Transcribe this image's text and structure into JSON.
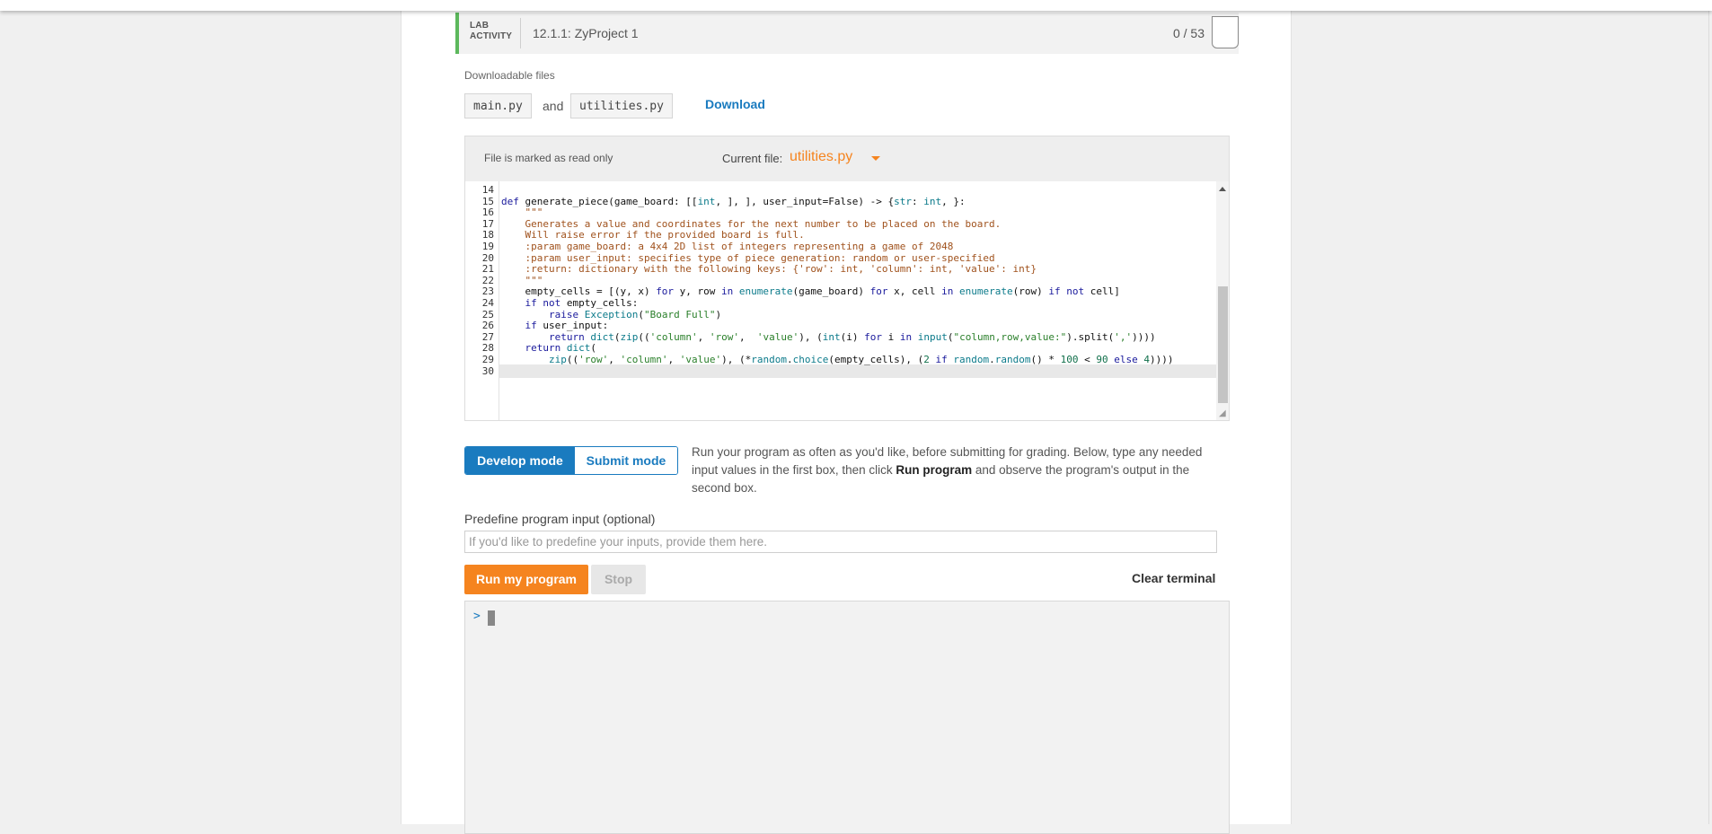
{
  "lab": {
    "tag_line1": "LAB",
    "tag_line2": "ACTIVITY",
    "title": "12.1.1: ZyProject 1",
    "score": "0 / 53"
  },
  "downloads": {
    "label": "Downloadable files",
    "file1": "main.py",
    "and_text": "and",
    "file2": "utilities.py",
    "download_label": "Download"
  },
  "editor": {
    "readonly_note": "File is marked as read only",
    "current_file_label": "Current file:",
    "current_file": "utilities.py",
    "active_line": 30,
    "lines": [
      {
        "n": "14",
        "code": ""
      },
      {
        "n": "15",
        "code": "def generate_piece(game_board: [[int, ], ], user_input=False) -> {str: int, }:"
      },
      {
        "n": "16",
        "code": "    \"\"\""
      },
      {
        "n": "17",
        "code": "    Generates a value and coordinates for the next number to be placed on the board."
      },
      {
        "n": "18",
        "code": "    Will raise error if the provided board is full."
      },
      {
        "n": "19",
        "code": "    :param game_board: a 4x4 2D list of integers representing a game of 2048"
      },
      {
        "n": "20",
        "code": "    :param user_input: specifies type of piece generation: random or user-specified"
      },
      {
        "n": "21",
        "code": "    :return: dictionary with the following keys: {'row': int, 'column': int, 'value': int}"
      },
      {
        "n": "22",
        "code": "    \"\"\""
      },
      {
        "n": "23",
        "code": "    empty_cells = [(y, x) for y, row in enumerate(game_board) for x, cell in enumerate(row) if not cell]"
      },
      {
        "n": "24",
        "code": "    if not empty_cells:"
      },
      {
        "n": "25",
        "code": "        raise Exception(\"Board Full\")"
      },
      {
        "n": "26",
        "code": "    if user_input:"
      },
      {
        "n": "27",
        "code": "        return dict(zip(('column', 'row',  'value'), (int(i) for i in input(\"column,row,value:\").split(','))))"
      },
      {
        "n": "28",
        "code": "    return dict("
      },
      {
        "n": "29",
        "code": "        zip(('row', 'column', 'value'), (*random.choice(empty_cells), (2 if random.random() * 100 < 90 else 4))))"
      },
      {
        "n": "30",
        "code": ""
      }
    ]
  },
  "modes": {
    "develop_label": "Develop mode",
    "submit_label": "Submit mode",
    "description_part1": "Run your program as often as you'd like, before submitting for grading. Below, type any needed input values in the first box, then click ",
    "description_bold": "Run program",
    "description_part2": " and observe the program's output in the second box."
  },
  "input": {
    "label": "Predefine program input (optional)",
    "placeholder": "If you'd like to predefine your inputs, provide them here.",
    "value": ""
  },
  "actions": {
    "run_label": "Run my program",
    "stop_label": "Stop",
    "clear_label": "Clear terminal"
  },
  "terminal": {
    "prompt": ">"
  },
  "colors": {
    "accent_blue": "#1a7bbf",
    "accent_orange": "#f5841f",
    "lab_green": "#5cb85c"
  }
}
